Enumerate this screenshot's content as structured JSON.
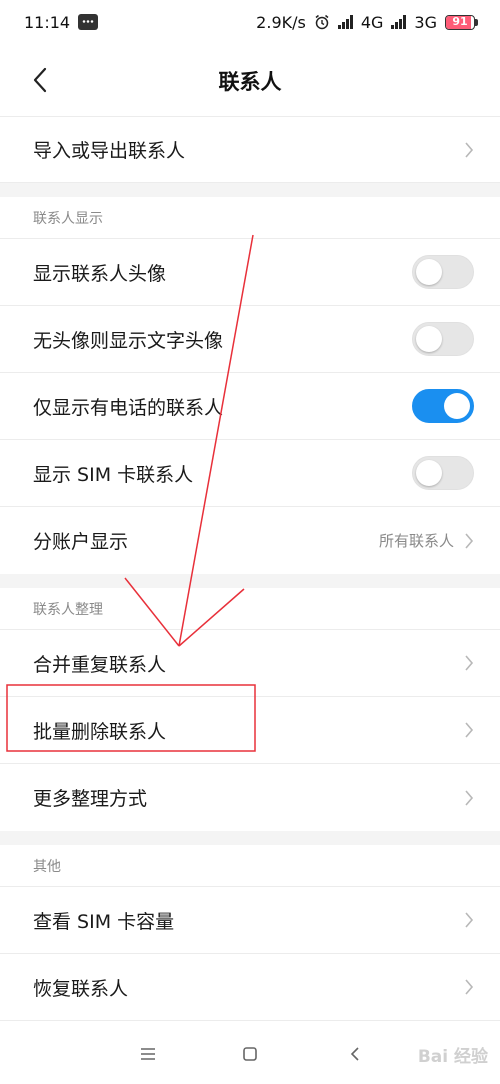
{
  "status_bar": {
    "time": "11:14",
    "net_speed": "2.9K/s",
    "sim1_net": "4G",
    "sim2_net": "3G",
    "battery": "91",
    "battery_level": 0.91
  },
  "header": {
    "title": "联系人"
  },
  "rows": {
    "import_export": "导入或导出联系人"
  },
  "sections": {
    "display": {
      "title": "联系人显示",
      "show_avatar": {
        "label": "显示联系人头像",
        "on": false
      },
      "text_avatar": {
        "label": "无头像则显示文字头像",
        "on": false
      },
      "phone_only": {
        "label": "仅显示有电话的联系人",
        "on": true
      },
      "sim_contacts": {
        "label": "显示 SIM 卡联系人",
        "on": false
      },
      "accounts": {
        "label": "分账户显示",
        "value": "所有联系人"
      }
    },
    "organize": {
      "title": "联系人整理",
      "merge": "合并重复联系人",
      "batch_delete": "批量删除联系人",
      "more_ways": "更多整理方式"
    },
    "other": {
      "title": "其他",
      "sim_capacity": "查看 SIM 卡容量",
      "restore": "恢复联系人"
    }
  },
  "watermark": "Bai 经验",
  "colors": {
    "toggle_on": "#1a8ff0",
    "annotation": "#e8303a",
    "battery": "#ff5c77"
  }
}
